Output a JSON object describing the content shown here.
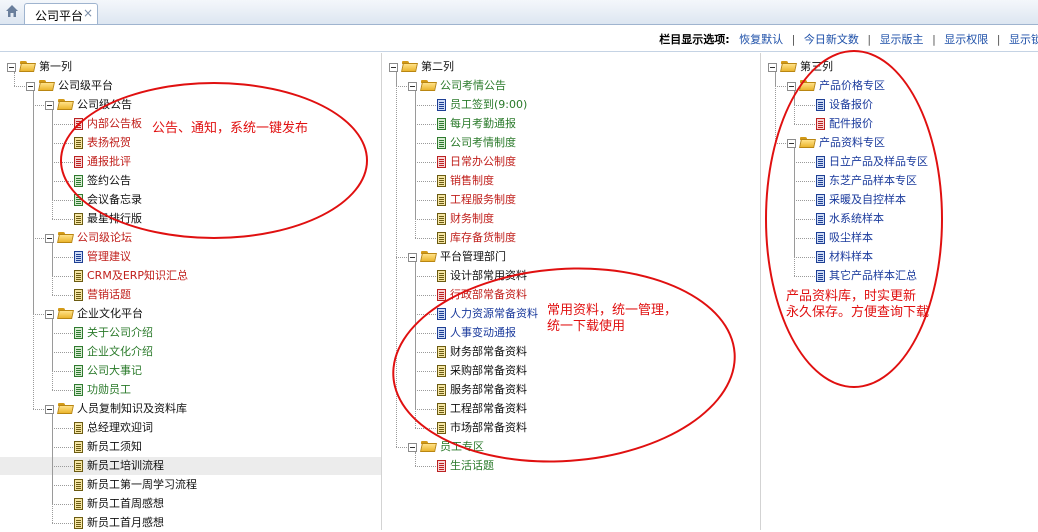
{
  "tab": {
    "label": "公司平台",
    "close": "×"
  },
  "options_bar": {
    "title": "栏目显示选项:",
    "items": [
      "恢复默认",
      "今日新文数",
      "显示版主",
      "显示权限",
      "显示锁"
    ]
  },
  "columns": [
    {
      "root": "第一列",
      "nodes": [
        {
          "label": "公司级平台",
          "kind": "folder",
          "depth": 1
        },
        {
          "label": "公司级公告",
          "kind": "folder",
          "depth": 2
        },
        {
          "label": "内部公告板",
          "kind": "doc",
          "icon_color": "red",
          "text_color": "red",
          "depth": 3
        },
        {
          "label": "表扬祝贺",
          "kind": "doc",
          "icon_color": "yellow",
          "text_color": "red",
          "depth": 3
        },
        {
          "label": "通报批评",
          "kind": "doc",
          "icon_color": "red",
          "text_color": "red",
          "depth": 3
        },
        {
          "label": "签约公告",
          "kind": "doc",
          "icon_color": "green",
          "text_color": "black",
          "depth": 3
        },
        {
          "label": "会议备忘录",
          "kind": "doc",
          "icon_color": "green",
          "text_color": "black",
          "depth": 3
        },
        {
          "label": "最星排行版",
          "kind": "doc",
          "icon_color": "yellow",
          "text_color": "black",
          "depth": 3
        },
        {
          "label": "公司级论坛",
          "kind": "folder",
          "text_color": "red",
          "depth": 2
        },
        {
          "label": "管理建议",
          "kind": "doc",
          "icon_color": "blue",
          "text_color": "red",
          "depth": 3
        },
        {
          "label": "CRM及ERP知识汇总",
          "kind": "doc",
          "icon_color": "yellow",
          "text_color": "red",
          "depth": 3
        },
        {
          "label": "营销话题",
          "kind": "doc",
          "icon_color": "yellow",
          "text_color": "red",
          "depth": 3
        },
        {
          "label": "企业文化平台",
          "kind": "folder",
          "depth": 2
        },
        {
          "label": "关于公司介绍",
          "kind": "doc",
          "icon_color": "green",
          "text_color": "green",
          "depth": 3
        },
        {
          "label": "企业文化介绍",
          "kind": "doc",
          "icon_color": "green",
          "text_color": "green",
          "depth": 3
        },
        {
          "label": "公司大事记",
          "kind": "doc",
          "icon_color": "green",
          "text_color": "green",
          "depth": 3
        },
        {
          "label": "功勋员工",
          "kind": "doc",
          "icon_color": "green",
          "text_color": "green",
          "depth": 3
        },
        {
          "label": "人员复制知识及资料库",
          "kind": "folder",
          "depth": 2
        },
        {
          "label": "总经理欢迎词",
          "kind": "doc",
          "icon_color": "yellow",
          "text_color": "black",
          "depth": 3
        },
        {
          "label": "新员工须知",
          "kind": "doc",
          "icon_color": "yellow",
          "text_color": "black",
          "depth": 3
        },
        {
          "label": "新员工培训流程",
          "kind": "doc",
          "icon_color": "yellow",
          "text_color": "black",
          "depth": 3,
          "highlight": true
        },
        {
          "label": "新员工第一周学习流程",
          "kind": "doc",
          "icon_color": "yellow",
          "text_color": "black",
          "depth": 3
        },
        {
          "label": "新员工首周感想",
          "kind": "doc",
          "icon_color": "yellow",
          "text_color": "black",
          "depth": 3
        },
        {
          "label": "新员工首月感想",
          "kind": "doc",
          "icon_color": "yellow",
          "text_color": "black",
          "depth": 3
        }
      ]
    },
    {
      "root": "第二列",
      "nodes": [
        {
          "label": "公司考情公告",
          "kind": "folder",
          "text_color": "green",
          "depth": 1
        },
        {
          "label": "员工签到(9:00)",
          "kind": "doc",
          "icon_color": "blue",
          "text_color": "green",
          "depth": 2
        },
        {
          "label": "每月考勤通报",
          "kind": "doc",
          "icon_color": "green",
          "text_color": "green",
          "depth": 2
        },
        {
          "label": "公司考情制度",
          "kind": "doc",
          "icon_color": "green",
          "text_color": "green",
          "depth": 2
        },
        {
          "label": "日常办公制度",
          "kind": "doc",
          "icon_color": "red",
          "text_color": "red",
          "depth": 2
        },
        {
          "label": "销售制度",
          "kind": "doc",
          "icon_color": "yellow",
          "text_color": "red",
          "depth": 2
        },
        {
          "label": "工程服务制度",
          "kind": "doc",
          "icon_color": "yellow",
          "text_color": "red",
          "depth": 2
        },
        {
          "label": "财务制度",
          "kind": "doc",
          "icon_color": "yellow",
          "text_color": "red",
          "depth": 2
        },
        {
          "label": "库存备货制度",
          "kind": "doc",
          "icon_color": "yellow",
          "text_color": "red",
          "depth": 2
        },
        {
          "label": "平台管理部门",
          "kind": "folder",
          "depth": 1
        },
        {
          "label": "设计部常用资料",
          "kind": "doc",
          "icon_color": "yellow",
          "text_color": "black",
          "depth": 2
        },
        {
          "label": "行政部常备资料",
          "kind": "doc",
          "icon_color": "red",
          "text_color": "red",
          "depth": 2
        },
        {
          "label": "人力资源常备资料",
          "kind": "doc",
          "icon_color": "blue",
          "text_color": "blue",
          "depth": 2
        },
        {
          "label": "人事变动通报",
          "kind": "doc",
          "icon_color": "blue",
          "text_color": "blue",
          "depth": 2
        },
        {
          "label": "财务部常备资料",
          "kind": "doc",
          "icon_color": "yellow",
          "text_color": "black",
          "depth": 2
        },
        {
          "label": "采购部常备资料",
          "kind": "doc",
          "icon_color": "yellow",
          "text_color": "black",
          "depth": 2
        },
        {
          "label": "服务部常备资料",
          "kind": "doc",
          "icon_color": "yellow",
          "text_color": "black",
          "depth": 2
        },
        {
          "label": "工程部常备资料",
          "kind": "doc",
          "icon_color": "yellow",
          "text_color": "black",
          "depth": 2
        },
        {
          "label": "市场部常备资料",
          "kind": "doc",
          "icon_color": "yellow",
          "text_color": "black",
          "depth": 2
        },
        {
          "label": "员工专区",
          "kind": "folder",
          "text_color": "green",
          "depth": 1
        },
        {
          "label": "生活话题",
          "kind": "doc",
          "icon_color": "red",
          "text_color": "green",
          "depth": 2
        }
      ]
    },
    {
      "root": "第三列",
      "nodes": [
        {
          "label": "产品价格专区",
          "kind": "folder",
          "text_color": "blue",
          "depth": 1
        },
        {
          "label": "设备报价",
          "kind": "doc",
          "icon_color": "blue",
          "text_color": "blue",
          "depth": 2
        },
        {
          "label": "配件报价",
          "kind": "doc",
          "icon_color": "red",
          "text_color": "blue",
          "depth": 2
        },
        {
          "label": "产品资料专区",
          "kind": "folder",
          "text_color": "blue",
          "depth": 1
        },
        {
          "label": "日立产品及样品专区",
          "kind": "doc",
          "icon_color": "blue",
          "text_color": "blue",
          "depth": 2
        },
        {
          "label": "东芝产品样本专区",
          "kind": "doc",
          "icon_color": "blue",
          "text_color": "blue",
          "depth": 2
        },
        {
          "label": "采暖及自控样本",
          "kind": "doc",
          "icon_color": "blue",
          "text_color": "blue",
          "depth": 2
        },
        {
          "label": "水系统样本",
          "kind": "doc",
          "icon_color": "blue",
          "text_color": "blue",
          "depth": 2
        },
        {
          "label": "吸尘样本",
          "kind": "doc",
          "icon_color": "blue",
          "text_color": "blue",
          "depth": 2
        },
        {
          "label": "材料样本",
          "kind": "doc",
          "icon_color": "blue",
          "text_color": "blue",
          "depth": 2
        },
        {
          "label": "其它产品样本汇总",
          "kind": "doc",
          "icon_color": "blue",
          "text_color": "blue",
          "depth": 2
        }
      ]
    }
  ],
  "annotations": [
    {
      "text": "公告、通知，系统一键发布"
    },
    {
      "text": "常用资料，统一管理，\n统一下载使用"
    },
    {
      "text": "产品资料库，时实更新\n永久保存。方便查询下载"
    }
  ],
  "colors": {
    "annotation": "#e01010",
    "link_blue": "#1d4fa8",
    "text_red": "#c0201c",
    "text_green": "#2a7a2a",
    "text_blue": "#1a3a9c"
  }
}
